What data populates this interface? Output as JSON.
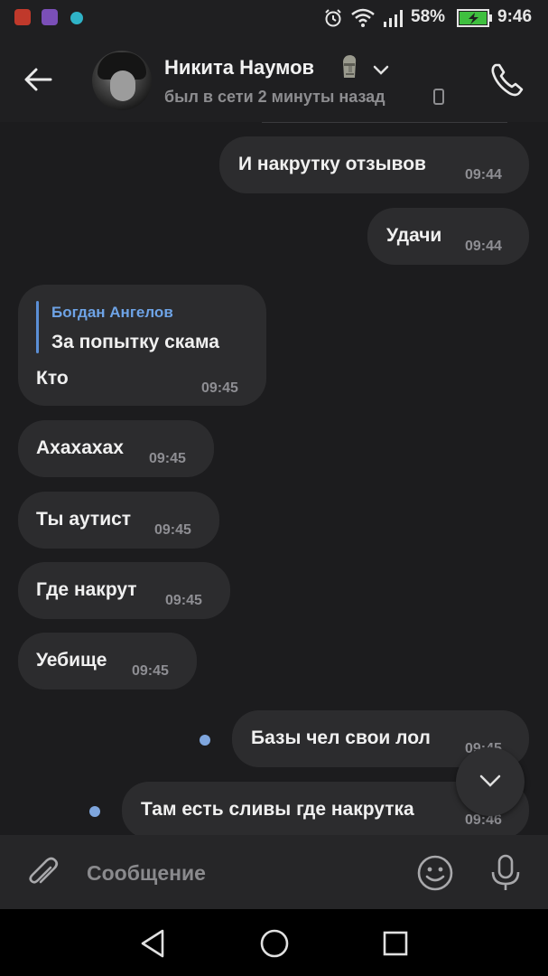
{
  "status_bar": {
    "battery": "58%",
    "time": "9:46",
    "app_icons": [
      "record-app-icon",
      "image-app-icon",
      "cloud-app-icon"
    ],
    "colors": {
      "app1": "#c0392b",
      "app2": "#7b4fb8",
      "app3": "#2fb3c7",
      "battery_fill": "#3fbf3f"
    }
  },
  "header": {
    "contact_name": "Никита Наумов",
    "last_seen": "был в сети 2 минуты назад",
    "name_emoji_icon": "moai-emoji-icon"
  },
  "messages": [
    {
      "id": "m1",
      "side": "out",
      "text": "И накрутку отзывов",
      "time": "09:44"
    },
    {
      "id": "m2",
      "side": "out",
      "text": "Удачи",
      "time": "09:44"
    },
    {
      "id": "m3",
      "side": "in",
      "reply_author": "Богдан Ангелов",
      "reply_text": "За попытку скама",
      "text": "Кто",
      "time": "09:45"
    },
    {
      "id": "m4",
      "side": "in",
      "text": "Ахахахах",
      "time": "09:45"
    },
    {
      "id": "m5",
      "side": "in",
      "text": "Ты аутист",
      "time": "09:45"
    },
    {
      "id": "m6",
      "side": "in",
      "text": "Где накрут",
      "time": "09:45"
    },
    {
      "id": "m7",
      "side": "in",
      "text": "Уебище",
      "time": "09:45"
    },
    {
      "id": "m8",
      "side": "out",
      "unread": true,
      "text": "Базы чел свои лол",
      "time": "09:45"
    },
    {
      "id": "m9",
      "side": "out",
      "unread": true,
      "text": "Там есть сливы где накрутка",
      "time": "09:46"
    }
  ],
  "composer": {
    "placeholder": "Сообщение"
  },
  "theme": {
    "accent": "#6ea3e6",
    "bubble": "#2c2c2e",
    "background": "#1c1c1e"
  }
}
